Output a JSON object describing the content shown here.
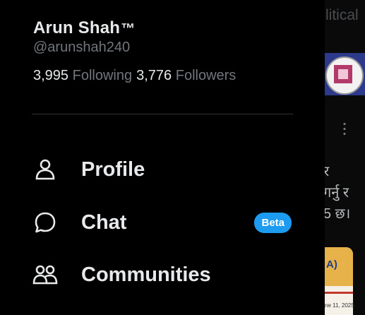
{
  "profile": {
    "name": "Arun Shah",
    "trademark": "™",
    "handle": "@arunshah240",
    "following_count": "3,995",
    "following_label": "Following",
    "followers_count": "3,776",
    "followers_label": "Followers"
  },
  "menu": [
    {
      "label": "Profile",
      "icon": "person-icon"
    },
    {
      "label": "Chat",
      "icon": "chat-bubble-icon",
      "badge": "Beta"
    },
    {
      "label": "Communities",
      "icon": "communities-icon"
    }
  ],
  "background_feed": {
    "tab_text": "litical",
    "text_lines": [
      "र",
      "गर्नु र",
      "5 छ।"
    ],
    "card_text": "A)",
    "card_date": "ne 11, 2025"
  },
  "colors": {
    "background": "#000000",
    "primary_text": "#e7e9ea",
    "secondary_text": "#71767b",
    "divider": "#2f3336",
    "accent": "#1d9bf0"
  }
}
